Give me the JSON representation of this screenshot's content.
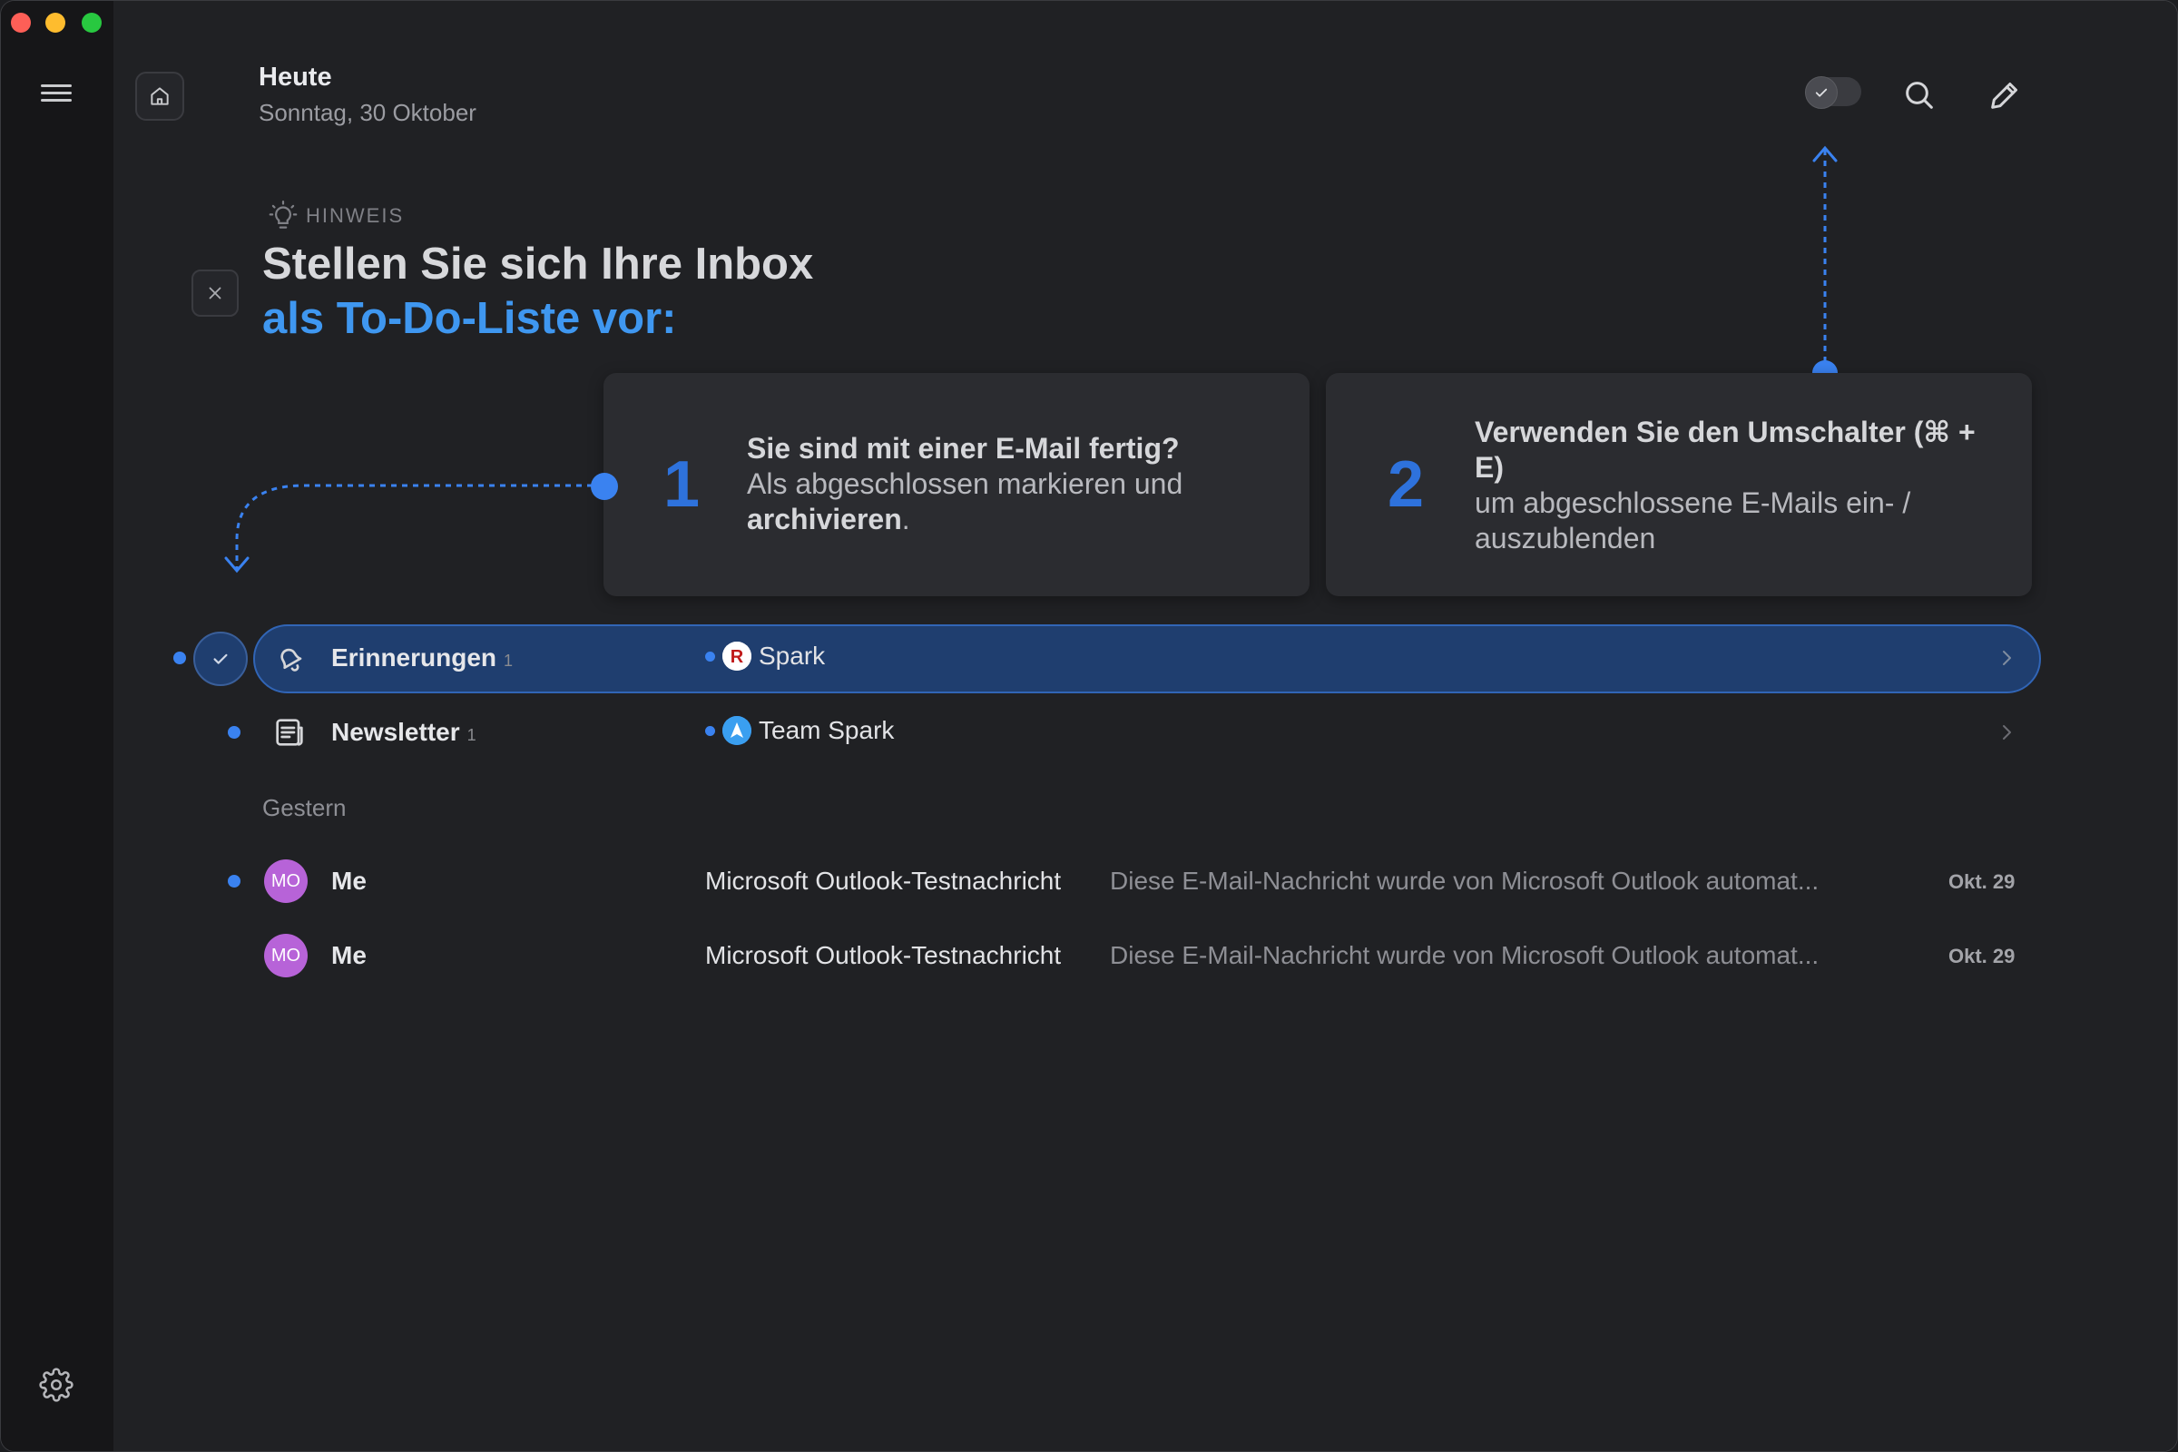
{
  "header": {
    "title": "Heute",
    "date": "Sonntag, 30 Oktober"
  },
  "hint": {
    "label": "HINWEIS",
    "title_line1": "Stellen Sie sich Ihre Inbox",
    "title_line2": "als To-Do-Liste vor:",
    "cards": [
      {
        "number": "1",
        "bold": "Sie sind mit einer E-Mail fertig?",
        "text": "Als abgeschlossen markieren und",
        "text_bold": "archivieren",
        "text_end": "."
      },
      {
        "number": "2",
        "bold": "Verwenden Sie den Umschalter (⌘ + E)",
        "text": "um abgeschlossene E-Mails ein- / auszublenden"
      }
    ]
  },
  "groups": [
    {
      "name": "Erinnerungen",
      "count": "1",
      "sender": "Spark",
      "icon": "bell-icon"
    },
    {
      "name": "Newsletter",
      "count": "1",
      "sender": "Team Spark",
      "icon": "newspaper-icon"
    }
  ],
  "section": "Gestern",
  "mails": [
    {
      "avatar": "MO",
      "from": "Me",
      "subject": "Microsoft Outlook-Testnachricht",
      "preview": "Diese E-Mail-Nachricht wurde von Microsoft Outlook automat...",
      "date": "Okt. 29",
      "unread": true
    },
    {
      "avatar": "MO",
      "from": "Me",
      "subject": "Microsoft Outlook-Testnachricht",
      "preview": "Diese E-Mail-Nachricht wurde von Microsoft Outlook automat...",
      "date": "Okt. 29",
      "unread": false
    }
  ],
  "colors": {
    "accent": "#3a82f0",
    "selected_row": "#1f3e6f",
    "avatar": "#b763d8",
    "hint_blue": "#3f97f0"
  }
}
